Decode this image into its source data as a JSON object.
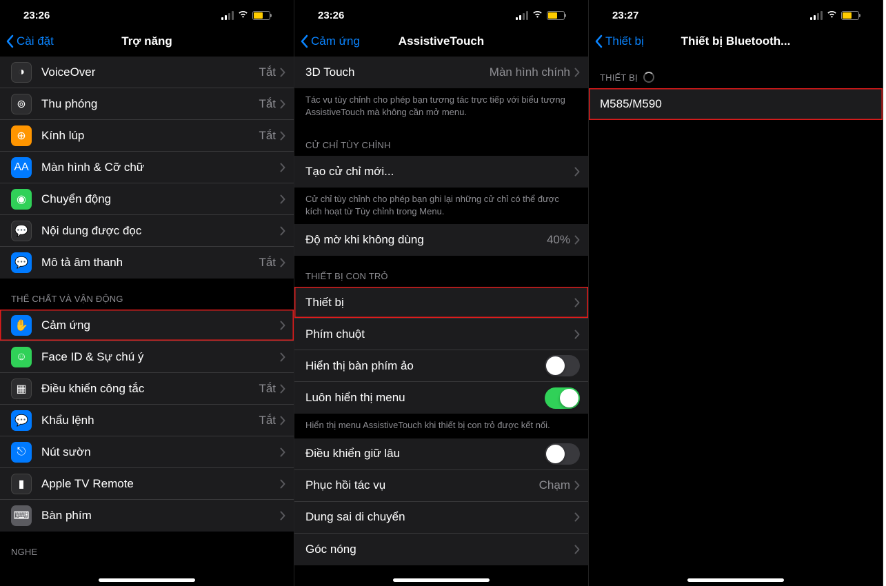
{
  "screens": [
    {
      "time": "23:26",
      "back": "Cài đặt",
      "title": "Trợ năng",
      "sections": [
        {
          "rows": [
            {
              "icon": "voiceover",
              "iconbg": "bg-darkgray",
              "label": "VoiceOver",
              "value": "Tắt",
              "chev": true
            },
            {
              "icon": "zoom",
              "iconbg": "bg-darkgray",
              "label": "Thu phóng",
              "value": "Tắt",
              "chev": true
            },
            {
              "icon": "magnifier",
              "iconbg": "bg-orange",
              "label": "Kính lúp",
              "value": "Tắt",
              "chev": true
            },
            {
              "icon": "text-size",
              "iconbg": "bg-blue",
              "label": "Màn hình & Cỡ chữ",
              "value": "",
              "chev": true
            },
            {
              "icon": "motion",
              "iconbg": "bg-green",
              "label": "Chuyển động",
              "value": "",
              "chev": true
            },
            {
              "icon": "spoken",
              "iconbg": "bg-darkgray",
              "label": "Nội dung được đọc",
              "value": "",
              "chev": true
            },
            {
              "icon": "audio-desc",
              "iconbg": "bg-blue",
              "label": "Mô tả âm thanh",
              "value": "Tắt",
              "chev": true
            }
          ]
        },
        {
          "header": "THỂ CHẤT VÀ VẬN ĐỘNG",
          "rows": [
            {
              "icon": "touch",
              "iconbg": "bg-blue",
              "label": "Cảm ứng",
              "value": "",
              "chev": true,
              "highlight": true
            },
            {
              "icon": "faceid",
              "iconbg": "bg-green",
              "label": "Face ID & Sự chú ý",
              "value": "",
              "chev": true
            },
            {
              "icon": "switch",
              "iconbg": "bg-darkgray",
              "label": "Điều khiển công tắc",
              "value": "Tắt",
              "chev": true
            },
            {
              "icon": "voice-ctrl",
              "iconbg": "bg-blue",
              "label": "Khẩu lệnh",
              "value": "Tắt",
              "chev": true
            },
            {
              "icon": "side-button",
              "iconbg": "bg-blue",
              "label": "Nút sườn",
              "value": "",
              "chev": true
            },
            {
              "icon": "tv-remote",
              "iconbg": "bg-darkgray",
              "label": "Apple TV Remote",
              "value": "",
              "chev": true
            },
            {
              "icon": "keyboard",
              "iconbg": "bg-gray",
              "label": "Bàn phím",
              "value": "",
              "chev": true
            }
          ]
        },
        {
          "header": "NGHE",
          "rows": []
        }
      ]
    },
    {
      "time": "23:26",
      "back": "Cảm ứng",
      "title": "AssistiveTouch",
      "sections": [
        {
          "rows": [
            {
              "label": "3D Touch",
              "value": "Màn hình chính",
              "chev": true
            }
          ],
          "footer": "Tác vụ tùy chỉnh cho phép bạn tương tác trực tiếp với biểu tượng AssistiveTouch mà không cần mở menu."
        },
        {
          "header": "CỬ CHỈ TÙY CHỈNH",
          "rows": [
            {
              "label": "Tạo cử chỉ mới...",
              "value": "",
              "chev": true
            }
          ],
          "footer": "Cử chỉ tùy chỉnh cho phép bạn ghi lại những cử chỉ có thể được kích hoạt từ Tùy chỉnh trong Menu."
        },
        {
          "rows": [
            {
              "label": "Độ mờ khi không dùng",
              "value": "40%",
              "chev": true
            }
          ]
        },
        {
          "header": "THIẾT BỊ CON TRỎ",
          "rows": [
            {
              "label": "Thiết bị",
              "value": "",
              "chev": true,
              "highlight": true
            },
            {
              "label": "Phím chuột",
              "value": "",
              "chev": true
            },
            {
              "label": "Hiển thị bàn phím ảo",
              "toggle": "off"
            },
            {
              "label": "Luôn hiển thị menu",
              "toggle": "on"
            }
          ],
          "footer": "Hiển thị menu AssistiveTouch khi thiết bị con trỏ được kết nối."
        },
        {
          "rows": [
            {
              "label": "Điều khiển giữ lâu",
              "toggle": "off"
            },
            {
              "label": "Phục hồi tác vụ",
              "value": "Chạm",
              "chev": true
            },
            {
              "label": "Dung sai di chuyển",
              "value": "",
              "chev": true
            },
            {
              "label": "Góc nóng",
              "value": "",
              "chev": true
            }
          ]
        }
      ]
    },
    {
      "time": "23:27",
      "back": "Thiết bị",
      "title": "Thiết bị Bluetooth...",
      "sections": [
        {
          "header": "THIẾT BỊ",
          "spinner": true,
          "rows": [
            {
              "label": "M585/M590",
              "value": "",
              "chev": false,
              "highlight": true
            }
          ]
        }
      ]
    }
  ]
}
